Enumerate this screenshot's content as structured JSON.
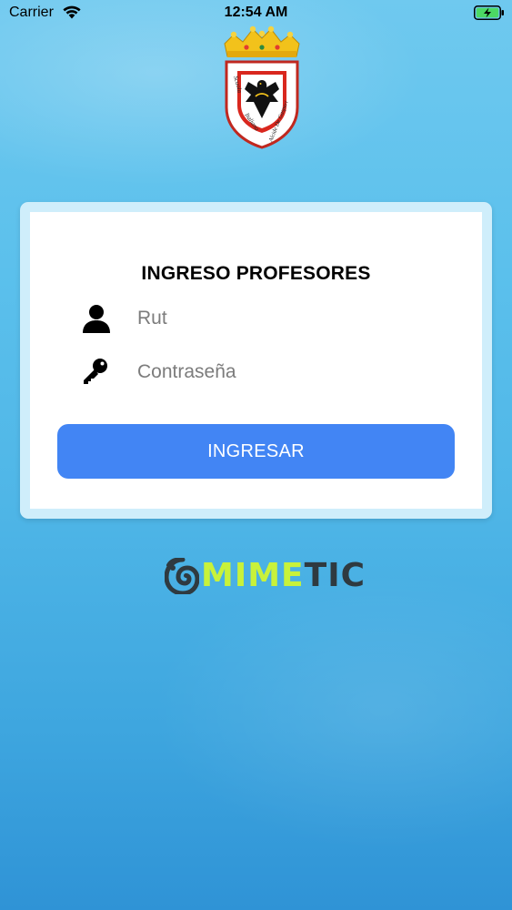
{
  "status_bar": {
    "carrier": "Carrier",
    "time": "12:54 AM"
  },
  "crest": {
    "motto_left": "Scuola",
    "motto_middle": "Italiana",
    "motto_right": "Alcide De Gasperi"
  },
  "login": {
    "title": "INGRESO PROFESORES",
    "rut_placeholder": "Rut",
    "password_placeholder": "Contraseña",
    "submit_label": "INGRESAR",
    "user_icon": "person-icon",
    "password_icon": "key-icon"
  },
  "brand": {
    "name_part1": "MIME",
    "name_part2": "TIC"
  },
  "colors": {
    "button": "#4285f4",
    "brand_lime": "#c8f23a",
    "brand_dark": "#2f3a40"
  }
}
